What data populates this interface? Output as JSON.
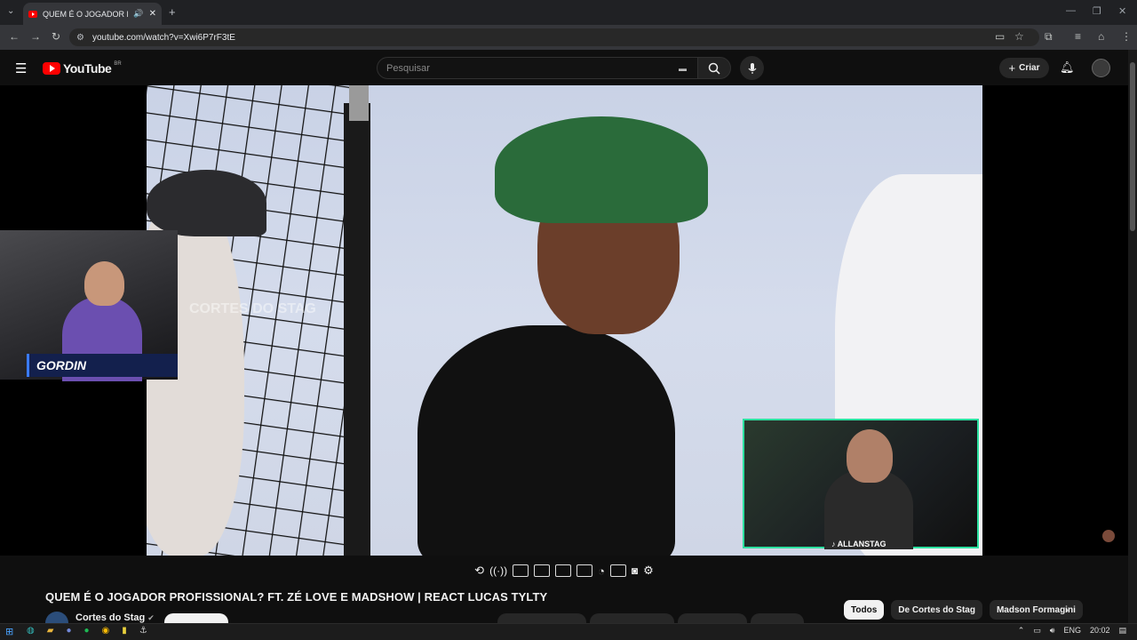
{
  "browser": {
    "tab_title": "QUEM É O JOGADOR PROF",
    "url": "youtube.com/watch?v=Xwi6P7rF3tE",
    "new_tab": "+"
  },
  "header": {
    "logo_text": "YouTube",
    "region": "BR",
    "search_placeholder": "Pesquisar",
    "create_label": "Criar"
  },
  "video": {
    "watermark": "CORTES DO STAG",
    "cam_left_name": "GORDIN",
    "cam_right_name": "ALLANSTAG"
  },
  "info": {
    "title": "QUEM É O JOGADOR PROFISSIONAL? FT. ZÉ LOVE E MADSHOW | REACT LUCAS TYLTY",
    "channel": "Cortes do Stag"
  },
  "chips": [
    "Todos",
    "De Cortes do Stag",
    "Madson Formagini"
  ],
  "taskbar": {
    "lang": "ENG",
    "time": "20:02"
  }
}
